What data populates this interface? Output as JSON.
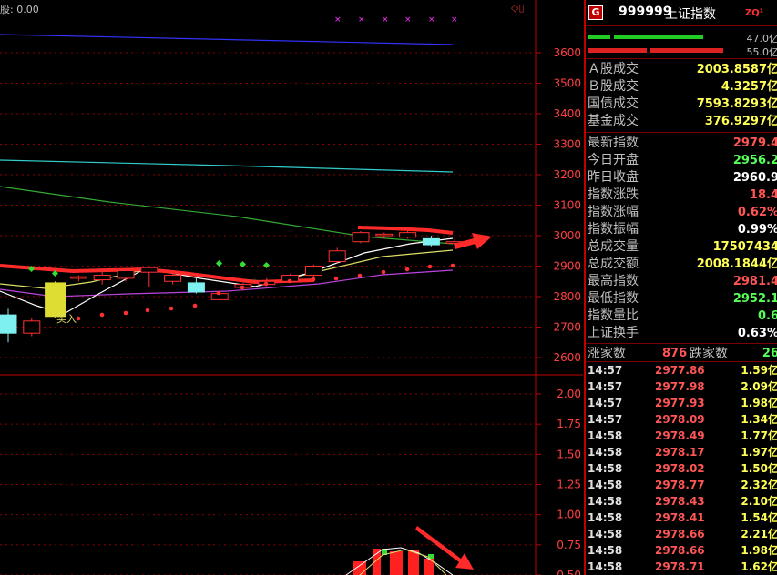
{
  "header": {
    "top_label": "股: 0.00",
    "icons": "◇▯"
  },
  "chart_data": [
    {
      "type": "candlestick",
      "y_axis_ticks": [
        "3600",
        "3500",
        "3400",
        "3300",
        "3200",
        "3100",
        "3000",
        "2900",
        "2800",
        "2700",
        "2600"
      ],
      "ylim": [
        2600,
        3600
      ],
      "annotation": "买入",
      "candles": [
        {
          "o": 2740,
          "c": 2680,
          "h": 2760,
          "l": 2650,
          "color": "cyan"
        },
        {
          "o": 2680,
          "c": 2720,
          "h": 2730,
          "l": 2670,
          "color": "red"
        },
        {
          "o": 2735,
          "c": 2845,
          "h": 2850,
          "l": 2730,
          "color": "yellow"
        },
        {
          "o": 2865,
          "c": 2860,
          "h": 2870,
          "l": 2850,
          "color": "red"
        },
        {
          "o": 2855,
          "c": 2870,
          "h": 2880,
          "l": 2840,
          "color": "red"
        },
        {
          "o": 2860,
          "c": 2885,
          "h": 2890,
          "l": 2850,
          "color": "red"
        },
        {
          "o": 2880,
          "c": 2895,
          "h": 2900,
          "l": 2830,
          "color": "red"
        },
        {
          "o": 2850,
          "c": 2870,
          "h": 2885,
          "l": 2840,
          "color": "red"
        },
        {
          "o": 2845,
          "c": 2815,
          "h": 2860,
          "l": 2810,
          "color": "cyan"
        },
        {
          "o": 2790,
          "c": 2810,
          "h": 2815,
          "l": 2785,
          "color": "red"
        },
        {
          "o": 2830,
          "c": 2840,
          "h": 2845,
          "l": 2820,
          "color": "red"
        },
        {
          "o": 2840,
          "c": 2850,
          "h": 2860,
          "l": 2835,
          "color": "red"
        },
        {
          "o": 2850,
          "c": 2870,
          "h": 2875,
          "l": 2845,
          "color": "red"
        },
        {
          "o": 2870,
          "c": 2900,
          "h": 2905,
          "l": 2860,
          "color": "red"
        },
        {
          "o": 2915,
          "c": 2950,
          "h": 2960,
          "l": 2910,
          "color": "red"
        },
        {
          "o": 2980,
          "c": 3010,
          "h": 3015,
          "l": 2975,
          "color": "red"
        },
        {
          "o": 3000,
          "c": 3005,
          "h": 3010,
          "l": 2990,
          "color": "red"
        },
        {
          "o": 2995,
          "c": 3010,
          "h": 3015,
          "l": 2990,
          "color": "red"
        },
        {
          "o": 2990,
          "c": 2970,
          "h": 3000,
          "l": 2965,
          "color": "cyan"
        },
        {
          "o": 2975,
          "c": 2980,
          "h": 2990,
          "l": 2970,
          "color": "red"
        }
      ]
    },
    {
      "type": "bar",
      "y_axis_ticks": [
        "2.00",
        "1.75",
        "1.50",
        "1.25",
        "1.00",
        "0.75",
        "0.50"
      ],
      "ylim": [
        0.5,
        2.0
      ]
    }
  ],
  "panel": {
    "code": "999999",
    "name": "上证指数",
    "tag": "ZQ¹",
    "bar1_label": "47.0亿",
    "bar2_label": "55.0亿",
    "turnover": [
      {
        "label": "Ａ股成交",
        "value": "2003.8587亿",
        "color": "#ffff55"
      },
      {
        "label": "Ｂ股成交",
        "value": "4.3257亿",
        "color": "#ffff55"
      },
      {
        "label": "国债成交",
        "value": "7593.8293亿",
        "color": "#ffff55"
      },
      {
        "label": "基金成交",
        "value": "376.9297亿",
        "color": "#ffff55"
      }
    ],
    "stats": [
      {
        "label": "最新指数",
        "value": "2979.4",
        "color": "#ff5555"
      },
      {
        "label": "今日开盘",
        "value": "2956.2",
        "color": "#55ff55"
      },
      {
        "label": "昨日收盘",
        "value": "2960.9",
        "color": "#ffffff"
      },
      {
        "label": "指数涨跌",
        "value": "18.4",
        "color": "#ff5555"
      },
      {
        "label": "指数涨幅",
        "value": "0.62%",
        "color": "#ff5555"
      },
      {
        "label": "指数振幅",
        "value": "0.99%",
        "color": "#ffffff"
      },
      {
        "label": "总成交量",
        "value": "17507434",
        "color": "#ffff55"
      },
      {
        "label": "总成交额",
        "value": "2008.1844亿",
        "color": "#ffff55"
      },
      {
        "label": "最高指数",
        "value": "2981.4",
        "color": "#ff5555"
      },
      {
        "label": "最低指数",
        "value": "2952.1",
        "color": "#55ff55"
      },
      {
        "label": "指数量比",
        "value": "0.6",
        "color": "#55ff55"
      },
      {
        "label": "上证换手",
        "value": "0.63%",
        "color": "#ffffff"
      }
    ],
    "rise_label": "涨家数",
    "rise_count": "876",
    "fall_label": "跌家数",
    "fall_count": "26",
    "ticks": [
      {
        "time": "14:57",
        "price": "2977.86",
        "vol": "1.59亿"
      },
      {
        "time": "14:57",
        "price": "2977.98",
        "vol": "2.09亿"
      },
      {
        "time": "14:57",
        "price": "2977.93",
        "vol": "1.98亿"
      },
      {
        "time": "14:57",
        "price": "2978.09",
        "vol": "1.34亿"
      },
      {
        "time": "14:58",
        "price": "2978.49",
        "vol": "1.77亿"
      },
      {
        "time": "14:58",
        "price": "2978.17",
        "vol": "1.97亿"
      },
      {
        "time": "14:58",
        "price": "2978.02",
        "vol": "1.50亿"
      },
      {
        "time": "14:58",
        "price": "2978.77",
        "vol": "2.32亿"
      },
      {
        "time": "14:58",
        "price": "2978.43",
        "vol": "2.10亿"
      },
      {
        "time": "14:58",
        "price": "2978.41",
        "vol": "1.54亿"
      },
      {
        "time": "14:58",
        "price": "2978.66",
        "vol": "2.21亿"
      },
      {
        "time": "14:58",
        "price": "2978.66",
        "vol": "1.98亿"
      },
      {
        "time": "14:58",
        "price": "2978.71",
        "vol": "1.62亿"
      }
    ]
  }
}
